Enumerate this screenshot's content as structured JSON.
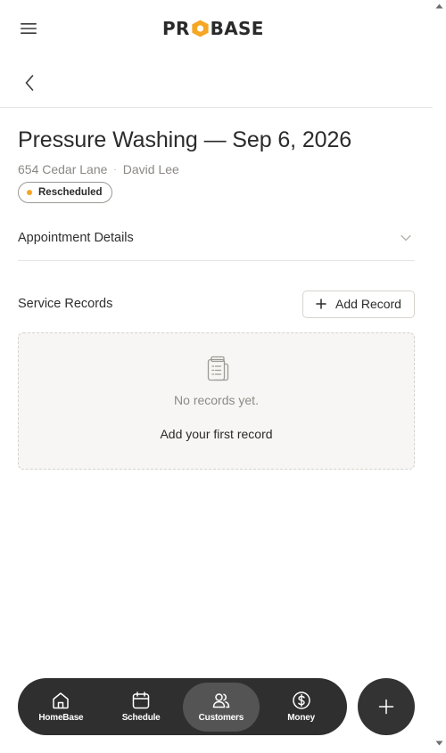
{
  "app": {
    "logo_text_left": "PR",
    "logo_text_right": "BASE",
    "logo_hex_color": "#f5a623"
  },
  "page": {
    "title": "Pressure Washing — Sep 6, 2026",
    "address": "654 Cedar Lane",
    "separator": "·",
    "customer": "David Lee",
    "status": {
      "label": "Rescheduled",
      "color": "#f5a623"
    }
  },
  "appointment_details": {
    "label": "Appointment Details"
  },
  "service_records": {
    "label": "Service Records",
    "add_button": "Add Record",
    "empty_message": "No records yet.",
    "empty_cta": "Add your first record"
  },
  "nav": {
    "items": [
      {
        "label": "HomeBase",
        "icon": "home-icon",
        "active": false
      },
      {
        "label": "Schedule",
        "icon": "calendar-icon",
        "active": false
      },
      {
        "label": "Customers",
        "icon": "users-icon",
        "active": true
      },
      {
        "label": "Money",
        "icon": "dollar-icon",
        "active": false
      }
    ],
    "fab_icon": "plus-icon"
  },
  "colors": {
    "text": "#2b2b2b",
    "muted": "#8a8883",
    "nav_bg": "#2f2f2f",
    "nav_active": "#555454",
    "accent": "#f5a623"
  }
}
